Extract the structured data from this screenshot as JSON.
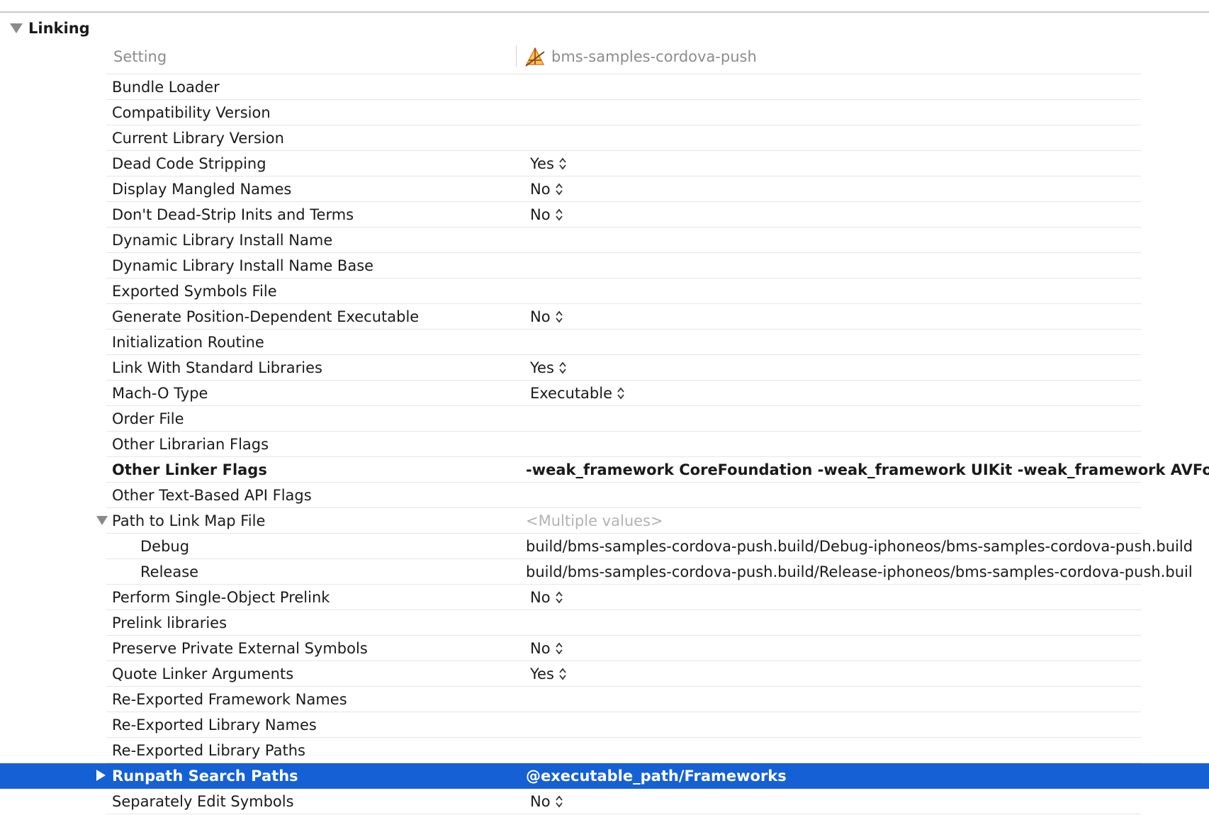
{
  "section": {
    "title": "Linking"
  },
  "header": {
    "setting_label": "Setting",
    "target_label": "bms-samples-cordova-push"
  },
  "rows": [
    {
      "name": "Bundle Loader",
      "value": ""
    },
    {
      "name": "Compatibility Version",
      "value": ""
    },
    {
      "name": "Current Library Version",
      "value": ""
    },
    {
      "name": "Dead Code Stripping",
      "value": "Yes",
      "popup": true
    },
    {
      "name": "Display Mangled Names",
      "value": "No",
      "popup": true
    },
    {
      "name": "Don't Dead-Strip Inits and Terms",
      "value": "No",
      "popup": true
    },
    {
      "name": "Dynamic Library Install Name",
      "value": ""
    },
    {
      "name": "Dynamic Library Install Name Base",
      "value": ""
    },
    {
      "name": "Exported Symbols File",
      "value": ""
    },
    {
      "name": "Generate Position-Dependent Executable",
      "value": "No",
      "popup": true
    },
    {
      "name": "Initialization Routine",
      "value": ""
    },
    {
      "name": "Link With Standard Libraries",
      "value": "Yes",
      "popup": true
    },
    {
      "name": "Mach-O Type",
      "value": "Executable",
      "popup": true
    },
    {
      "name": "Order File",
      "value": ""
    },
    {
      "name": "Other Librarian Flags",
      "value": ""
    },
    {
      "name": "Other Linker Flags",
      "value": "-weak_framework CoreFoundation -weak_framework UIKit -weak_framework AVFounda",
      "bold": true
    },
    {
      "name": "Other Text-Based API Flags",
      "value": ""
    },
    {
      "name": "Path to Link Map File",
      "value": "<Multiple values>",
      "muted": true,
      "disclosure": "down"
    },
    {
      "name": "Debug",
      "value": "build/bms-samples-cordova-push.build/Debug-iphoneos/bms-samples-cordova-push.build",
      "sub": true
    },
    {
      "name": "Release",
      "value": "build/bms-samples-cordova-push.build/Release-iphoneos/bms-samples-cordova-push.buil",
      "sub": true
    },
    {
      "name": "Perform Single-Object Prelink",
      "value": "No",
      "popup": true
    },
    {
      "name": "Prelink libraries",
      "value": ""
    },
    {
      "name": "Preserve Private External Symbols",
      "value": "No",
      "popup": true
    },
    {
      "name": "Quote Linker Arguments",
      "value": "Yes",
      "popup": true
    },
    {
      "name": "Re-Exported Framework Names",
      "value": ""
    },
    {
      "name": "Re-Exported Library Names",
      "value": ""
    },
    {
      "name": "Re-Exported Library Paths",
      "value": ""
    },
    {
      "name": "Runpath Search Paths",
      "value": "@executable_path/Frameworks",
      "bold": true,
      "selected": true,
      "disclosure": "right"
    },
    {
      "name": "Separately Edit Symbols",
      "value": "No",
      "popup": true
    }
  ],
  "colors": {
    "selection": "#1560d4",
    "muted": "#8c8c8c",
    "separator": "#e6e6e6"
  }
}
